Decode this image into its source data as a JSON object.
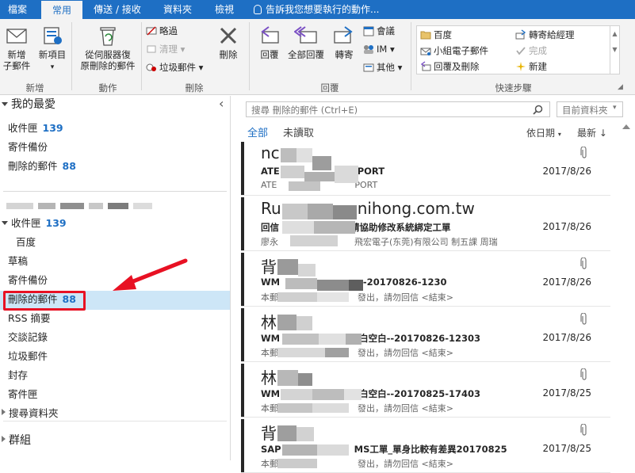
{
  "tabs": [
    {
      "label": "檔案",
      "active": false
    },
    {
      "label": "常用",
      "active": true
    },
    {
      "label": "傳送 / 接收",
      "active": false
    },
    {
      "label": "資料夾",
      "active": false
    },
    {
      "label": "檢視",
      "active": false
    }
  ],
  "tell_me": "告訴我您想要執行的動作...",
  "ribbon": {
    "new_email": "新增\n子郵件",
    "new_items": "新項目",
    "new_items_arrow": "▾",
    "recover": "從伺服器復\n原刪除的郵件",
    "ignore": "略過",
    "cleanup": "清理",
    "junk": "垃圾郵件",
    "delete": "刪除",
    "reply": "回覆",
    "reply_all": "全部回覆",
    "forward": "轉寄",
    "meeting": "會議",
    "im": "IM",
    "more": "其他",
    "groups": {
      "new": "新增",
      "actions": "動作",
      "delete": "刪除",
      "respond": "回覆",
      "quick_steps": "快速步驟"
    },
    "quick_steps": [
      {
        "label": "百度",
        "icon": "folder-icon",
        "disabled": false
      },
      {
        "label": "小組電子郵件",
        "icon": "team-email-icon",
        "disabled": false
      },
      {
        "label": "回覆及刪除",
        "icon": "reply-delete-icon",
        "disabled": false
      },
      {
        "label": "轉寄給經理",
        "icon": "forward-manager-icon",
        "disabled": false
      },
      {
        "label": "完成",
        "icon": "checkmark-icon",
        "disabled": true
      },
      {
        "label": "新建",
        "icon": "sparkle-icon",
        "disabled": false
      }
    ]
  },
  "folders": {
    "favorites_header": "我的最愛",
    "collapse_glyph": "‹",
    "favorites": [
      {
        "label": "收件匣",
        "count": "139"
      },
      {
        "label": "寄件備份",
        "count": ""
      },
      {
        "label": "刪除的郵件",
        "count": "88"
      }
    ],
    "account_header": "",
    "account_items": [
      {
        "label": "收件匣",
        "count": "139"
      },
      {
        "label": "百度",
        "count": ""
      },
      {
        "label": "草稿",
        "count": ""
      },
      {
        "label": "寄件備份",
        "count": ""
      },
      {
        "label": "刪除的郵件",
        "count": "88"
      },
      {
        "label": "RSS 摘要",
        "count": ""
      },
      {
        "label": "交談記錄",
        "count": ""
      },
      {
        "label": "垃圾郵件",
        "count": ""
      },
      {
        "label": "封存",
        "count": ""
      },
      {
        "label": "寄件匣",
        "count": ""
      },
      {
        "label": "搜尋資料夾",
        "count": ""
      }
    ],
    "groups_header": "群組"
  },
  "list": {
    "search_placeholder": "搜尋 刪除的郵件 (Ctrl+E)",
    "scope": "目前資料夾",
    "filter_all": "全部",
    "filter_unread": "未讀取",
    "sort_by": "依日期",
    "sort_order": "最新 ↓",
    "colors": {
      "accent": "#1e6fc4",
      "selected": "#cde6f7",
      "highlight": "#e81123"
    },
    "messages": [
      {
        "sender": "nc",
        "sender_tail": "",
        "subject": "ATE",
        "subject_tail": "PORT",
        "preview": "ATE",
        "preview_tail": "PORT",
        "date": "2017/8/26",
        "attachment": true
      },
      {
        "sender": "Ru",
        "sender_tail": "nihong.com.tw",
        "subject": "回信",
        "subject_tail": "請協助修改系統綁定工單",
        "preview": "廖永",
        "preview_tail": "飛宏電子(东莞)有限公司 制五課 周瑞",
        "date": "2017/8/26",
        "attachment": false
      },
      {
        "sender": "背",
        "sender_tail": "",
        "subject": "WM",
        "subject_tail": "--20170826-1230",
        "preview": "本郵",
        "preview_tail": "發出，請勿回信 <結束>",
        "date": "2017/8/26",
        "attachment": true
      },
      {
        "sender": "林",
        "sender_tail": "",
        "subject": "WM",
        "subject_tail": "白空白--20170826-12303",
        "preview": "本郵",
        "preview_tail": "發出，請勿回信 <結束>",
        "date": "2017/8/26",
        "attachment": true
      },
      {
        "sender": "林",
        "sender_tail": "",
        "subject": "WM",
        "subject_tail": "白空白--20170825-17403",
        "preview": "本郵",
        "preview_tail": "發出，請勿回信 <結束>",
        "date": "2017/8/25",
        "attachment": true
      },
      {
        "sender": "背",
        "sender_tail": "",
        "subject": "SAP",
        "subject_tail": "MS工單_單身比較有差異20170825",
        "preview": "本郵",
        "preview_tail": "發出，請勿回信 <結束>",
        "date": "2017/8/25",
        "attachment": true
      }
    ]
  }
}
